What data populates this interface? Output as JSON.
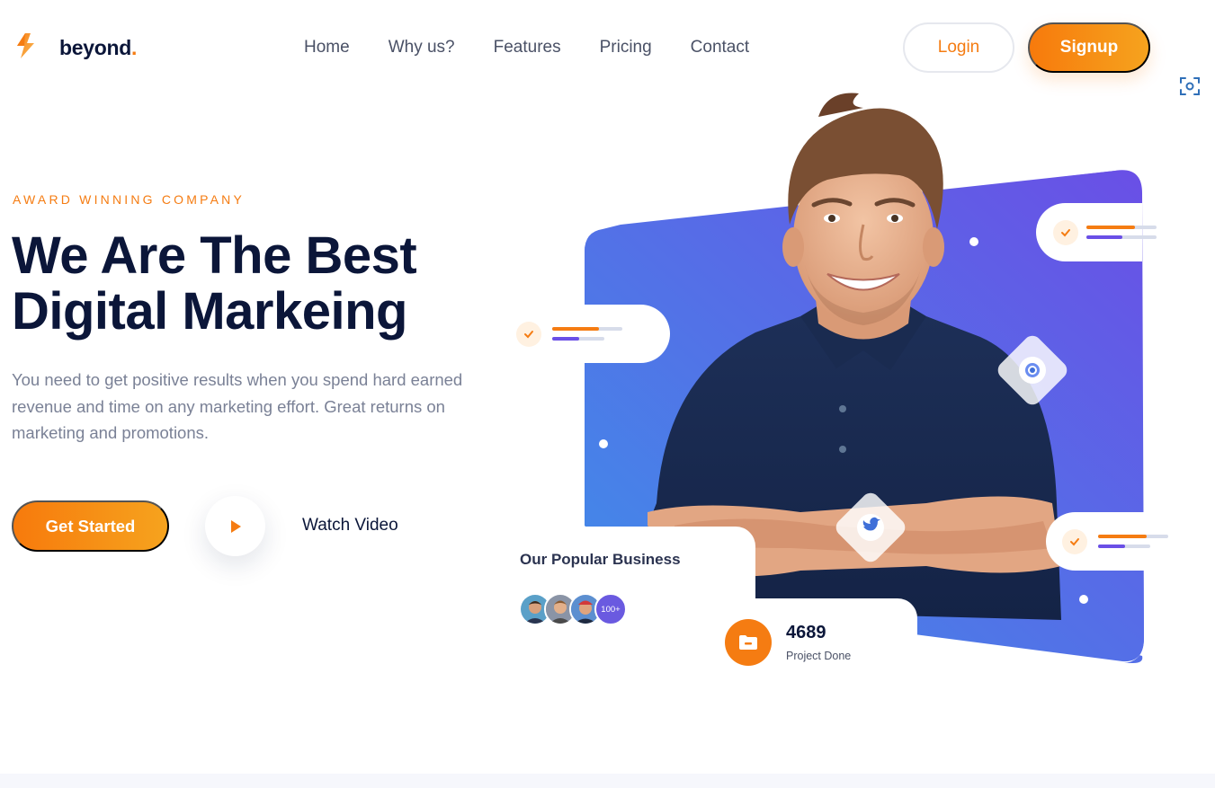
{
  "brand": {
    "name": "beyond",
    "dot": ".",
    "accent": "#f57c12",
    "accent_end": "#f6a31e",
    "dark": "#0b1639",
    "purple": "#6a4fe6",
    "blue": "#3f8ee8"
  },
  "nav": {
    "items": [
      {
        "label": "Home"
      },
      {
        "label": "Why us?"
      },
      {
        "label": "Features"
      },
      {
        "label": "Pricing"
      },
      {
        "label": "Contact"
      }
    ],
    "login_label": "Login",
    "signup_label": "Signup"
  },
  "hero": {
    "eyebrow": "AWARD WINNING COMPANY",
    "headline_line1": "We Are The Best",
    "headline_line2": "Digital Markeing",
    "subtext": "You need to get positive results when you spend hard earned revenue and time on any marketing effort. Great returns on marketing and promotions.",
    "cta_label": "Get Started",
    "video_label": "Watch Video"
  },
  "popular_business": {
    "title": "Our Popular Business",
    "more_label": "100+"
  },
  "project_stat": {
    "value": "4689",
    "label": "Project Done"
  },
  "icons": {
    "logo": "bolt-logo-icon",
    "scan": "scan-icon",
    "play": "play-icon",
    "check": "check-icon",
    "twitter": "twitter-bird-icon",
    "chat": "chat-bubble-icon",
    "folder": "folder-icon"
  }
}
